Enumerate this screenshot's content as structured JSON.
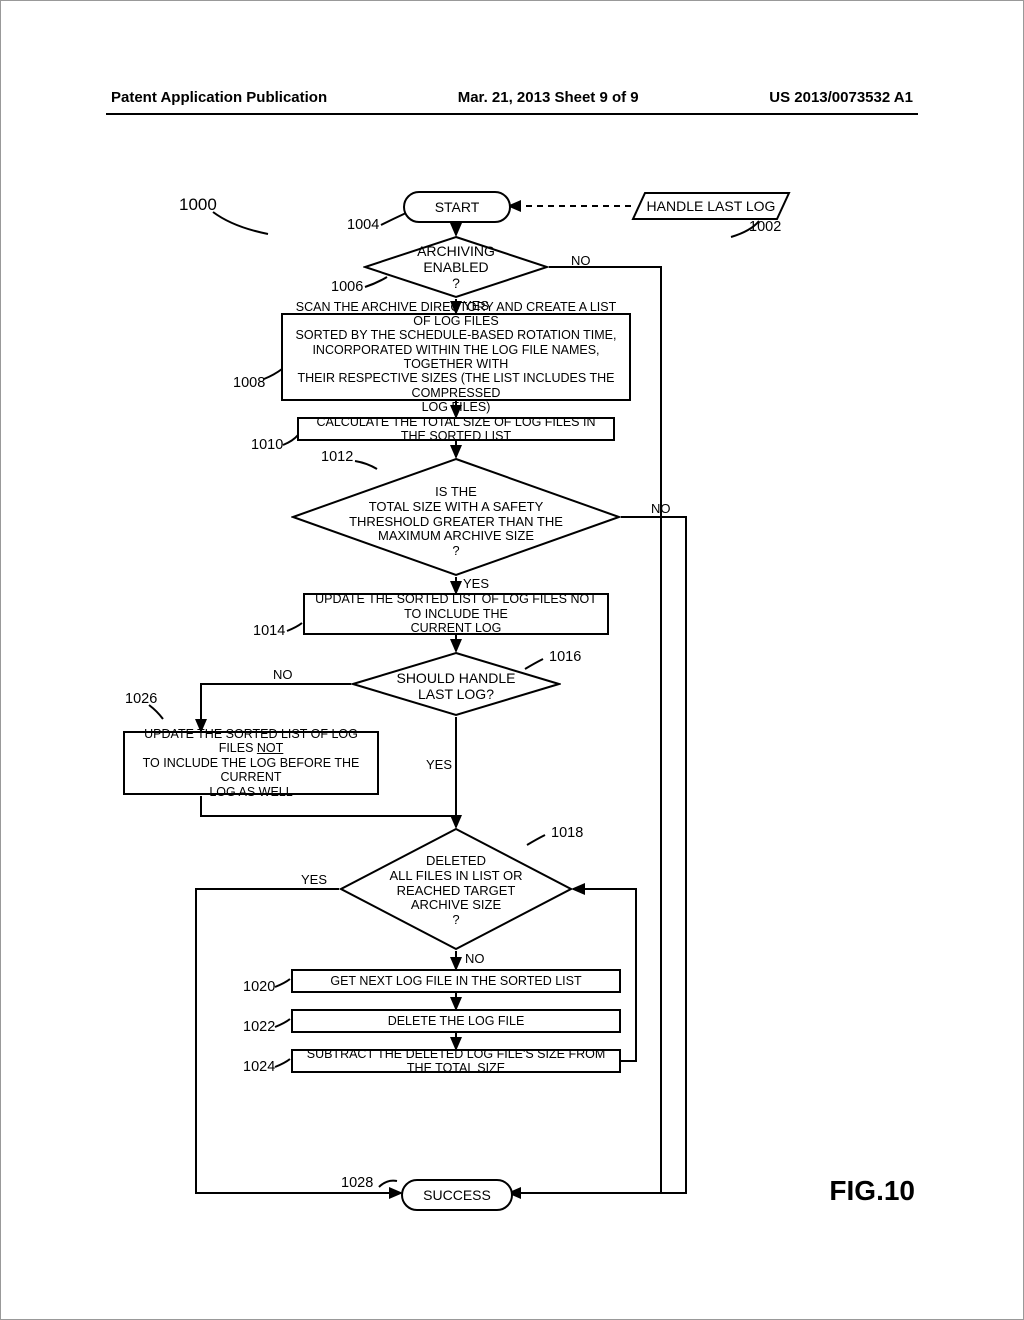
{
  "header": {
    "left": "Patent Application Publication",
    "center": "Mar. 21, 2013  Sheet 9 of 9",
    "right": "US 2013/0073532 A1"
  },
  "labels": {
    "l1000": "1000",
    "l1002": "1002",
    "l1004": "1004",
    "l1006": "1006",
    "l1008": "1008",
    "l1010": "1010",
    "l1012": "1012",
    "l1014": "1014",
    "l1016": "1016",
    "l1018": "1018",
    "l1020": "1020",
    "l1022": "1022",
    "l1024": "1024",
    "l1026": "1026",
    "l1028": "1028"
  },
  "shapes": {
    "start": "START",
    "handleInput": "HANDLE LAST LOG",
    "d_arch": "ARCHIVING\nENABLED\n?",
    "p_scan": "SCAN THE ARCHIVE DIRECTORY AND CREATE A LIST OF LOG FILES\nSORTED BY THE SCHEDULE-BASED ROTATION TIME,\nINCORPORATED WITHIN THE LOG FILE NAMES, TOGETHER WITH\nTHEIR RESPECTIVE SIZES (THE LIST INCLUDES THE COMPRESSED\nLOG FILES)",
    "p_calc": "CALCULATE THE TOTAL SIZE OF LOG FILES IN THE SORTED LIST",
    "d_total": "IS THE\nTOTAL SIZE WITH A SAFETY\nTHRESHOLD GREATER THAN THE\nMAXIMUM ARCHIVE SIZE\n?",
    "p_update": "UPDATE THE SORTED LIST OF LOG FILES NOT TO INCLUDE THE\nCURRENT LOG",
    "d_should": "SHOULD HANDLE\nLAST LOG?",
    "p_update2a": "UPDATE THE SORTED LIST OF LOG FILES ",
    "p_update2b": "NOT",
    "p_update2c": "TO INCLUDE THE LOG BEFORE THE CURRENT\nLOG AS WELL",
    "d_deleted": "DELETED\nALL FILES IN LIST OR\nREACHED TARGET\nARCHIVE SIZE\n?",
    "p_get": "GET NEXT LOG FILE IN THE SORTED LIST",
    "p_delete": "DELETE THE LOG FILE",
    "p_subtract": "SUBTRACT THE DELETED LOG FILE'S SIZE FROM THE TOTAL SIZE",
    "success": "SUCCESS"
  },
  "edges": {
    "yes": "YES",
    "no": "NO"
  },
  "figure": "FIG.10",
  "chart_data": {
    "type": "flowchart",
    "title": "FIG.10",
    "nodes": [
      {
        "id": "1002",
        "type": "input",
        "text": "HANDLE LAST LOG"
      },
      {
        "id": "1004",
        "type": "terminator",
        "text": "START"
      },
      {
        "id": "1006",
        "type": "decision",
        "text": "ARCHIVING ENABLED?"
      },
      {
        "id": "1008",
        "type": "process",
        "text": "SCAN THE ARCHIVE DIRECTORY AND CREATE A LIST OF LOG FILES SORTED BY THE SCHEDULE-BASED ROTATION TIME, INCORPORATED WITHIN THE LOG FILE NAMES, TOGETHER WITH THEIR RESPECTIVE SIZES (THE LIST INCLUDES THE COMPRESSED LOG FILES)"
      },
      {
        "id": "1010",
        "type": "process",
        "text": "CALCULATE THE TOTAL SIZE OF LOG FILES IN THE SORTED LIST"
      },
      {
        "id": "1012",
        "type": "decision",
        "text": "IS THE TOTAL SIZE WITH A SAFETY THRESHOLD GREATER THAN THE MAXIMUM ARCHIVE SIZE?"
      },
      {
        "id": "1014",
        "type": "process",
        "text": "UPDATE THE SORTED LIST OF LOG FILES NOT TO INCLUDE THE CURRENT LOG"
      },
      {
        "id": "1016",
        "type": "decision",
        "text": "SHOULD HANDLE LAST LOG?"
      },
      {
        "id": "1018",
        "type": "decision",
        "text": "DELETED ALL FILES IN LIST OR REACHED TARGET ARCHIVE SIZE?"
      },
      {
        "id": "1020",
        "type": "process",
        "text": "GET NEXT LOG FILE IN THE SORTED LIST"
      },
      {
        "id": "1022",
        "type": "process",
        "text": "DELETE THE LOG FILE"
      },
      {
        "id": "1024",
        "type": "process",
        "text": "SUBTRACT THE DELETED LOG FILE'S SIZE FROM THE TOTAL SIZE"
      },
      {
        "id": "1026",
        "type": "process",
        "text": "UPDATE THE SORTED LIST OF LOG FILES NOT TO INCLUDE THE LOG BEFORE THE CURRENT LOG AS WELL"
      },
      {
        "id": "1028",
        "type": "terminator",
        "text": "SUCCESS"
      }
    ],
    "edges": [
      {
        "from": "1002",
        "to": "1004",
        "style": "dashed"
      },
      {
        "from": "1004",
        "to": "1006"
      },
      {
        "from": "1006",
        "to": "1008",
        "label": "YES"
      },
      {
        "from": "1006",
        "to": "1028",
        "label": "NO"
      },
      {
        "from": "1008",
        "to": "1010"
      },
      {
        "from": "1010",
        "to": "1012"
      },
      {
        "from": "1012",
        "to": "1014",
        "label": "YES"
      },
      {
        "from": "1012",
        "to": "1028",
        "label": "NO"
      },
      {
        "from": "1014",
        "to": "1016"
      },
      {
        "from": "1016",
        "to": "1026",
        "label": "NO"
      },
      {
        "from": "1016",
        "to": "1018",
        "label": "YES"
      },
      {
        "from": "1026",
        "to": "1018"
      },
      {
        "from": "1018",
        "to": "1020",
        "label": "NO"
      },
      {
        "from": "1018",
        "to": "1028",
        "label": "YES"
      },
      {
        "from": "1020",
        "to": "1022"
      },
      {
        "from": "1022",
        "to": "1024"
      },
      {
        "from": "1024",
        "to": "1018"
      }
    ],
    "root_label": "1000"
  }
}
